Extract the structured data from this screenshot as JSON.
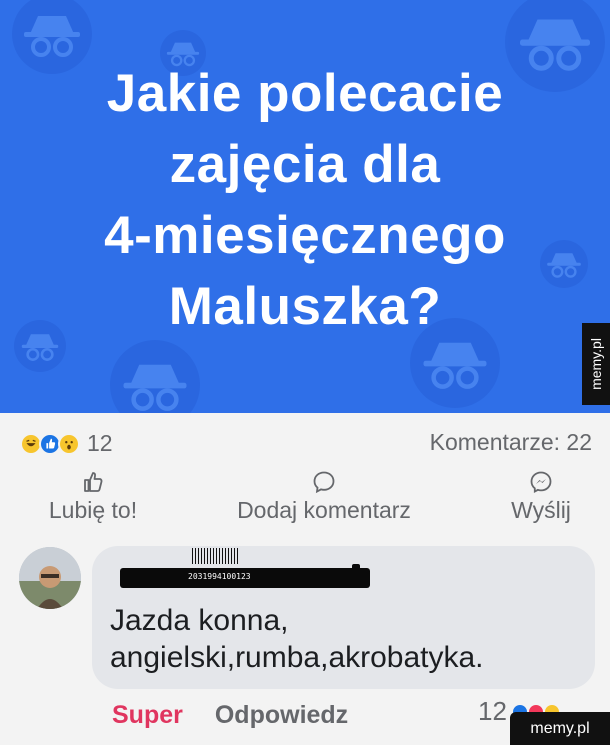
{
  "post": {
    "headline_lines": [
      "Jakie polecacie",
      "zajęcia dla",
      "4-miesięcznego",
      "Maluszka?"
    ],
    "background_color": "#2f6fe8"
  },
  "side_tag": "memy.pl",
  "stats": {
    "reaction_icons": [
      "haha-icon",
      "like-icon",
      "wow-icon"
    ],
    "reaction_count": "12",
    "comments_label": "Komentarze: 22"
  },
  "actions": {
    "like_label": "Lubię to!",
    "comment_label": "Dodaj komentarz",
    "send_label": "Wyślij"
  },
  "comment": {
    "barcode_text": "2031994100123",
    "text_line1": "Jazda konna,",
    "text_line2": "angielski,rumba,akrobatyka.",
    "reaction_label": "Super",
    "reply_label": "Odpowiedz",
    "reaction_count": "12"
  },
  "watermark": "memy.pl"
}
